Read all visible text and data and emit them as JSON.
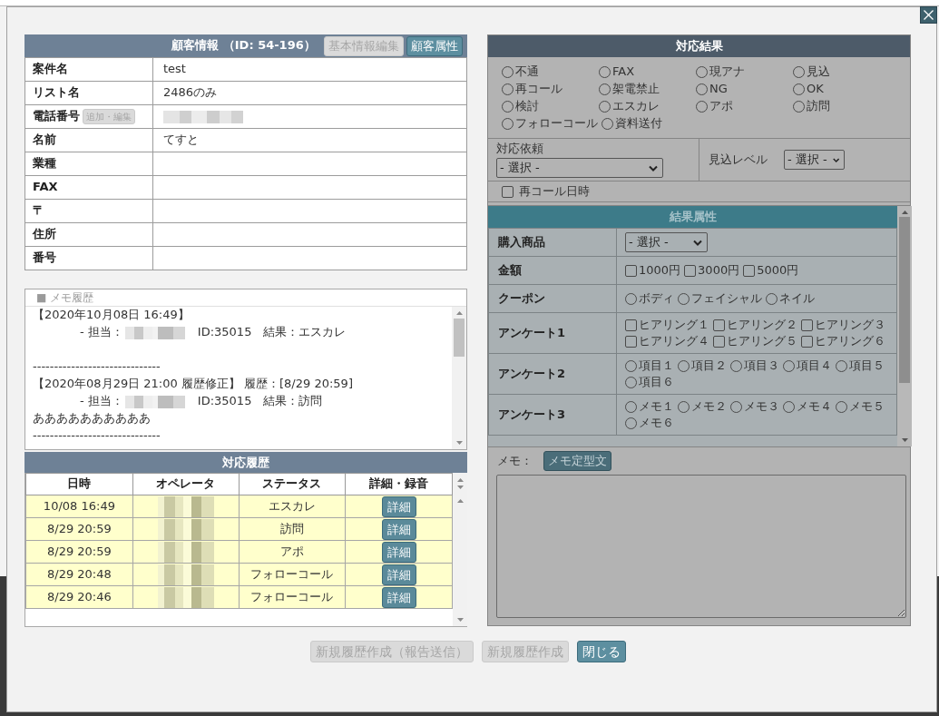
{
  "customer_info": {
    "title": "顧客情報 （ID: 54-196）",
    "buttons": [
      {
        "label": "基本情報編集",
        "disabled": true
      },
      {
        "label": "顧客属性",
        "disabled": false
      }
    ],
    "fields": [
      {
        "kind": "text",
        "label": "案件名",
        "value": "test"
      },
      {
        "kind": "text",
        "label": "リスト名",
        "value": "2486のみ"
      },
      {
        "kind": "blurred",
        "label": "電話番号",
        "button": {
          "label": "追加・編集",
          "disabled": true
        }
      },
      {
        "kind": "text",
        "label": "名前",
        "value": "てすと"
      },
      {
        "kind": "text",
        "label": "業種"
      },
      {
        "kind": "text",
        "label": "FAX"
      },
      {
        "kind": "text",
        "label": "〒"
      },
      {
        "kind": "text",
        "label": "住所"
      },
      {
        "kind": "text",
        "label": "番号"
      }
    ]
  },
  "memo_history": {
    "title": "■ メモ履歴",
    "lines": [
      {
        "kind": "text",
        "text": "【2020年10月08日 16:49】"
      },
      {
        "kind": "staff",
        "prefix": "- 担当：",
        "info": "ID:35015　結果：エスカレ"
      },
      {
        "kind": "blank"
      },
      {
        "kind": "text",
        "text": "------------------------------"
      },
      {
        "kind": "text",
        "text": "【2020年08月29日 21:00 履歴修正】 履歴：[8/29 20:59]"
      },
      {
        "kind": "staff",
        "prefix": "- 担当：",
        "info": "ID:35015　結果：訪問"
      },
      {
        "kind": "text",
        "text": "ああああああああああ"
      },
      {
        "kind": "text",
        "text": "------------------------------"
      }
    ]
  },
  "history": {
    "title": "対応履歴",
    "columns": [
      "日時",
      "オペレータ",
      "ステータス",
      "詳細・録音"
    ],
    "rows": [
      {
        "datetime": "10/08 16:49",
        "status": "エスカレ",
        "button": "詳細"
      },
      {
        "datetime": "8/29 20:59",
        "status": "訪問",
        "button": "詳細"
      },
      {
        "datetime": "8/29 20:59",
        "status": "アポ",
        "button": "詳細"
      },
      {
        "datetime": "8/29 20:48",
        "status": "フォローコール",
        "button": "詳細"
      },
      {
        "datetime": "8/29 20:46",
        "status": "フォローコール",
        "button": "詳細"
      }
    ]
  },
  "result": {
    "title": "対応結果",
    "options": [
      {
        "label": "不通",
        "selected": false
      },
      {
        "label": "FAX",
        "selected": false
      },
      {
        "label": "現アナ",
        "selected": false
      },
      {
        "label": "見込",
        "selected": false
      },
      {
        "label": "再コール",
        "selected": false
      },
      {
        "label": "架電禁止",
        "selected": false
      },
      {
        "label": "NG",
        "selected": false
      },
      {
        "label": "OK",
        "selected": false
      },
      {
        "label": "検討",
        "selected": false
      },
      {
        "label": "エスカレ",
        "selected": false
      },
      {
        "label": "アポ",
        "selected": false
      },
      {
        "label": "訪問",
        "selected": false
      },
      {
        "label": "フォローコール",
        "selected": false
      },
      {
        "label": "資料送付",
        "selected": false
      }
    ],
    "request": {
      "label": "対応依頼",
      "value": "- 選択 -"
    },
    "prospect_level": {
      "label": "見込レベル",
      "value": "- 選択 -"
    },
    "recall": {
      "label": "再コール日時",
      "checked": false
    }
  },
  "attributes": {
    "title": "結果属性",
    "rows": [
      {
        "kind": "select",
        "label": "購入商品",
        "value": "- 選択 -"
      },
      {
        "kind": "checkbox",
        "label": "金額",
        "options": [
          {
            "label": "1000円",
            "checked": false
          },
          {
            "label": "3000円",
            "checked": false
          },
          {
            "label": "5000円",
            "checked": false
          }
        ]
      },
      {
        "kind": "radio",
        "label": "クーポン",
        "options": [
          {
            "label": "ボディ",
            "selected": false
          },
          {
            "label": "フェイシャル",
            "selected": false
          },
          {
            "label": "ネイル",
            "selected": false
          }
        ]
      },
      {
        "kind": "checkbox",
        "label": "アンケート1",
        "options": [
          {
            "label": "ヒアリング１",
            "checked": false
          },
          {
            "label": "ヒアリング２",
            "checked": false
          },
          {
            "label": "ヒアリング３",
            "checked": false
          },
          {
            "label": "ヒアリング４",
            "checked": false
          },
          {
            "label": "ヒアリング５",
            "checked": false
          },
          {
            "label": "ヒアリング６",
            "checked": false
          }
        ]
      },
      {
        "kind": "radio",
        "label": "アンケート2",
        "options": [
          {
            "label": "項目１",
            "selected": false
          },
          {
            "label": "項目２",
            "selected": false
          },
          {
            "label": "項目３",
            "selected": false
          },
          {
            "label": "項目４",
            "selected": false
          },
          {
            "label": "項目５",
            "selected": false
          },
          {
            "label": "項目６",
            "selected": false
          }
        ]
      },
      {
        "kind": "radio",
        "label": "アンケート3",
        "options": [
          {
            "label": "メモ１",
            "selected": false
          },
          {
            "label": "メモ２",
            "selected": false
          },
          {
            "label": "メモ３",
            "selected": false
          },
          {
            "label": "メモ４",
            "selected": false
          },
          {
            "label": "メモ５",
            "selected": false
          },
          {
            "label": "メモ６",
            "selected": false
          }
        ]
      }
    ]
  },
  "memo": {
    "label": "メモ：",
    "button": "メモ定型文"
  },
  "footer_buttons": [
    {
      "label": "新規履歴作成（報告送信）",
      "disabled": true
    },
    {
      "label": "新規履歴作成",
      "disabled": true
    },
    {
      "label": "閉じる",
      "disabled": false
    }
  ]
}
